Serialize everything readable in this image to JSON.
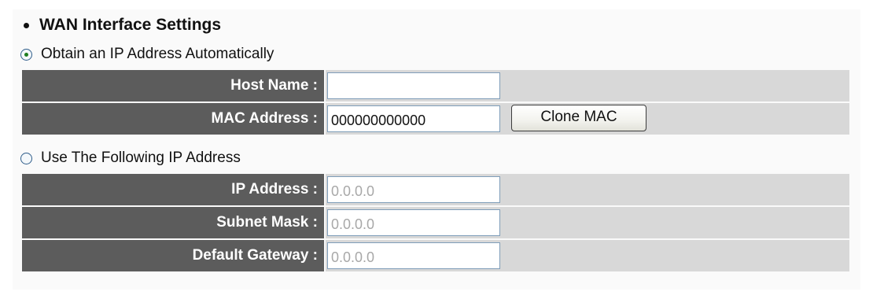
{
  "section": {
    "title": "WAN Interface Settings"
  },
  "auto_ip": {
    "label": "Obtain an IP Address Automatically",
    "selected": true,
    "fields": [
      {
        "label": "Host Name :",
        "value": ""
      },
      {
        "label": "MAC Address :",
        "value": "000000000000"
      }
    ],
    "clone_mac_label": "Clone MAC"
  },
  "static_ip": {
    "label": "Use The Following IP Address",
    "selected": false,
    "fields": [
      {
        "label": "IP Address :",
        "value": "0.0.0.0"
      },
      {
        "label": "Subnet Mask :",
        "value": "0.0.0.0"
      },
      {
        "label": "Default Gateway :",
        "value": "0.0.0.0"
      }
    ]
  },
  "colors": {
    "label_cell": "#5c5c5c",
    "value_cell": "#d8d8d8",
    "radio_selected": "#1e7d1e",
    "disabled_text": "#a8a8a8"
  }
}
